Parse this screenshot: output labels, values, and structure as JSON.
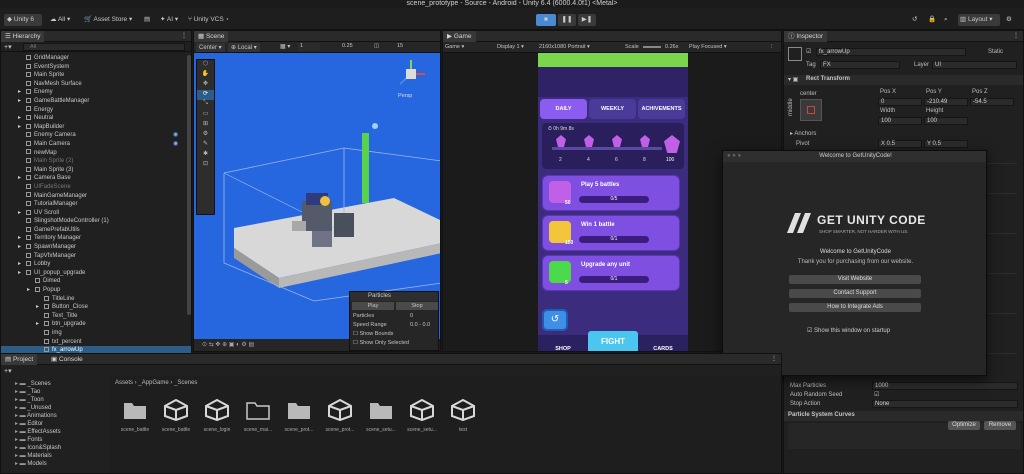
{
  "window": {
    "title": "scene_prototype - Source - Android - Unity 6.4 (6000.4.0f1) <Metal>"
  },
  "toolbar": {
    "account": "Unity 6",
    "all_label": "All",
    "asset_store": "Asset Store",
    "ai_label": "AI",
    "vcs_label": "Unity VCS",
    "layout_label": "Layout"
  },
  "hierarchy": {
    "tab": "Hierarchy",
    "search_placeholder": "All",
    "items": [
      {
        "label": "GridManager",
        "indent": 1,
        "dim": false,
        "eye": false,
        "arrow": false
      },
      {
        "label": "EventSystem",
        "indent": 1,
        "dim": false,
        "eye": false,
        "arrow": false
      },
      {
        "label": "Main Sprite",
        "indent": 1,
        "dim": false,
        "eye": false,
        "arrow": false
      },
      {
        "label": "NavMesh Surface",
        "indent": 1,
        "dim": false,
        "eye": false,
        "arrow": false
      },
      {
        "label": "Enemy",
        "indent": 1,
        "dim": false,
        "eye": false,
        "arrow": true
      },
      {
        "label": "GameBattleManager",
        "indent": 1,
        "dim": false,
        "eye": false,
        "arrow": true
      },
      {
        "label": "Energy",
        "indent": 1,
        "dim": false,
        "eye": false,
        "arrow": false
      },
      {
        "label": "Neutral",
        "indent": 1,
        "dim": false,
        "eye": false,
        "arrow": true
      },
      {
        "label": "MapBuilder",
        "indent": 1,
        "dim": false,
        "eye": false,
        "arrow": true
      },
      {
        "label": "Enemy Camera",
        "indent": 1,
        "dim": false,
        "eye": true,
        "arrow": false
      },
      {
        "label": "Main Camera",
        "indent": 1,
        "dim": false,
        "eye": true,
        "arrow": false
      },
      {
        "label": "newMap",
        "indent": 1,
        "dim": false,
        "eye": false,
        "arrow": false
      },
      {
        "label": "Main Sprite (2)",
        "indent": 1,
        "dim": true,
        "eye": false,
        "arrow": false
      },
      {
        "label": "Main Sprite (3)",
        "indent": 1,
        "dim": false,
        "eye": false,
        "arrow": false
      },
      {
        "label": "Camera Base",
        "indent": 1,
        "dim": false,
        "eye": false,
        "arrow": true
      },
      {
        "label": "UIFadeScene",
        "indent": 1,
        "dim": true,
        "eye": false,
        "arrow": false
      },
      {
        "label": "MainGameManager",
        "indent": 1,
        "dim": false,
        "eye": false,
        "arrow": false
      },
      {
        "label": "TutorialManager",
        "indent": 1,
        "dim": false,
        "eye": false,
        "arrow": false
      },
      {
        "label": "UV Scroll",
        "indent": 1,
        "dim": false,
        "eye": false,
        "arrow": true
      },
      {
        "label": "SlingshotModeController (1)",
        "indent": 1,
        "dim": false,
        "eye": false,
        "arrow": false
      },
      {
        "label": "GamePrefabUtils",
        "indent": 1,
        "dim": false,
        "eye": false,
        "arrow": false
      },
      {
        "label": "Territory Manager",
        "indent": 1,
        "dim": false,
        "eye": false,
        "arrow": true
      },
      {
        "label": "SpawnManager",
        "indent": 1,
        "dim": false,
        "eye": false,
        "arrow": true
      },
      {
        "label": "TapVfxManager",
        "indent": 1,
        "dim": false,
        "eye": false,
        "arrow": false
      },
      {
        "label": "Lobby",
        "indent": 1,
        "dim": false,
        "eye": false,
        "arrow": true
      },
      {
        "label": "UI_popup_upgrade",
        "indent": 1,
        "dim": false,
        "eye": false,
        "arrow": true
      },
      {
        "label": "Dimed",
        "indent": 2,
        "dim": false,
        "eye": false,
        "arrow": false
      },
      {
        "label": "Popup",
        "indent": 2,
        "dim": false,
        "eye": false,
        "arrow": true
      },
      {
        "label": "TitleLine",
        "indent": 3,
        "dim": false,
        "eye": false,
        "arrow": false
      },
      {
        "label": "Button_Close",
        "indent": 3,
        "dim": false,
        "eye": false,
        "arrow": true
      },
      {
        "label": "Text_Title",
        "indent": 3,
        "dim": false,
        "eye": false,
        "arrow": false
      },
      {
        "label": "btn_upgrade",
        "indent": 3,
        "dim": false,
        "eye": false,
        "arrow": true
      },
      {
        "label": "img",
        "indent": 3,
        "dim": false,
        "eye": false,
        "arrow": false
      },
      {
        "label": "txt_percent",
        "indent": 3,
        "dim": false,
        "eye": false,
        "arrow": false
      },
      {
        "label": "fx_arrowUp",
        "indent": 3,
        "dim": false,
        "eye": false,
        "arrow": false,
        "selected": true
      }
    ]
  },
  "scene": {
    "tab": "Scene",
    "pivot": "Center",
    "space": "Local",
    "snap_value": "0.25",
    "grid_count": "15",
    "view_label": "Persp",
    "particles": {
      "title": "Particles",
      "play": "Play",
      "stop": "Stop",
      "particles_label": "Particles",
      "particles_value": "0",
      "speed_label": "Speed Range",
      "speed_value": "0.0 - 0.0",
      "show_bounds": "Show Bounds",
      "show_only_selected": "Show Only Selected"
    }
  },
  "game": {
    "tab": "Game",
    "mode": "Game",
    "display": "Display 1",
    "resolution": "2160x1080 Portrait",
    "scale_label": "Scale",
    "scale_value": "0.26x",
    "play_focused": "Play Focused",
    "tabs": [
      "DAILY",
      "WEEKLY",
      "ACHIVEMENTS"
    ],
    "timer": "0h 9m 8s",
    "milestones": [
      "2",
      "4",
      "6",
      "8"
    ],
    "milestone_final": "100",
    "missions": [
      {
        "title": "Play 5 battles",
        "reward": "50",
        "progress": "0/5",
        "color": "#c060e6"
      },
      {
        "title": "Win 1 battle",
        "reward": "150",
        "progress": "0/1",
        "color": "#f2c53a"
      },
      {
        "title": "Upgrade any unit",
        "reward": "5",
        "progress": "0/1",
        "color": "#4cd94c"
      }
    ],
    "nav": [
      "SHOP",
      "FIGHT",
      "CARDS"
    ]
  },
  "inspector": {
    "tab": "Inspector",
    "object_name": "fx_arrowUp",
    "static_label": "Static",
    "tag_label": "Tag",
    "tag_value": "FX",
    "layer_label": "Layer",
    "layer_value": "UI",
    "component": "Rect Transform",
    "anchor_label": "center",
    "anchor_side": "middle",
    "pos_x_label": "Pos X",
    "pos_y_label": "Pos Y",
    "pos_z_label": "Pos Z",
    "pos_x": "0",
    "pos_y": "-210.49",
    "pos_z": "-54.5",
    "width_label": "Width",
    "height_label": "Height",
    "width": "100",
    "height": "100",
    "anchors": "Anchors",
    "pivot_label": "Pivot",
    "pivot_x": "X 0.5",
    "pivot_y": "Y 0.5",
    "max_particles_label": "Max Particles",
    "max_particles": "1000",
    "auto_random_label": "Auto Random Seed",
    "stop_action_label": "Stop Action",
    "stop_action": "None",
    "curves": "Particle System Curves",
    "optimize": "Optimize",
    "remove": "Remove"
  },
  "dialog": {
    "window_title": "Welcome to GetUnityCode!",
    "brand": "GET UNITY CODE",
    "tagline": "SHOP SMARTER, NOT HARDER WITH US.",
    "heading": "Welcome to GetUnityCode",
    "message": "Thank you for purchasing from our website.",
    "buttons": [
      "Visit Website",
      "Contact Support",
      "How to Integrate Ads"
    ],
    "checkbox": "Show this window on startup"
  },
  "project": {
    "tab": "Project",
    "console_tab": "Console",
    "breadcrumb": [
      "Assets",
      "_AppGame",
      "_Scenes"
    ],
    "folders": [
      {
        "label": "_Scenes",
        "indent": 1
      },
      {
        "label": "_Tao",
        "indent": 1
      },
      {
        "label": "_Toon",
        "indent": 1
      },
      {
        "label": "_Unused",
        "indent": 1
      },
      {
        "label": "Animations",
        "indent": 1
      },
      {
        "label": "Editor",
        "indent": 1
      },
      {
        "label": "EffectAssets",
        "indent": 1
      },
      {
        "label": "Fonts",
        "indent": 1
      },
      {
        "label": "Icon&Splash",
        "indent": 1
      },
      {
        "label": "Materials",
        "indent": 1
      },
      {
        "label": "Models",
        "indent": 1
      }
    ],
    "assets": [
      {
        "label": "scene_battle",
        "kind": "folder"
      },
      {
        "label": "scene_battle",
        "kind": "unity"
      },
      {
        "label": "scene_login",
        "kind": "unity"
      },
      {
        "label": "scene_mai...",
        "kind": "folder-outline"
      },
      {
        "label": "scene_prot...",
        "kind": "folder"
      },
      {
        "label": "scene_prot...",
        "kind": "unity"
      },
      {
        "label": "scene_setu...",
        "kind": "folder"
      },
      {
        "label": "scene_setu...",
        "kind": "unity"
      },
      {
        "label": "test",
        "kind": "unity"
      }
    ]
  },
  "colors": {
    "accent": "#2c5d87",
    "play_active": "#4a8ad4",
    "game_purple": "#7e4fe0",
    "game_green": "#7ad64a"
  }
}
